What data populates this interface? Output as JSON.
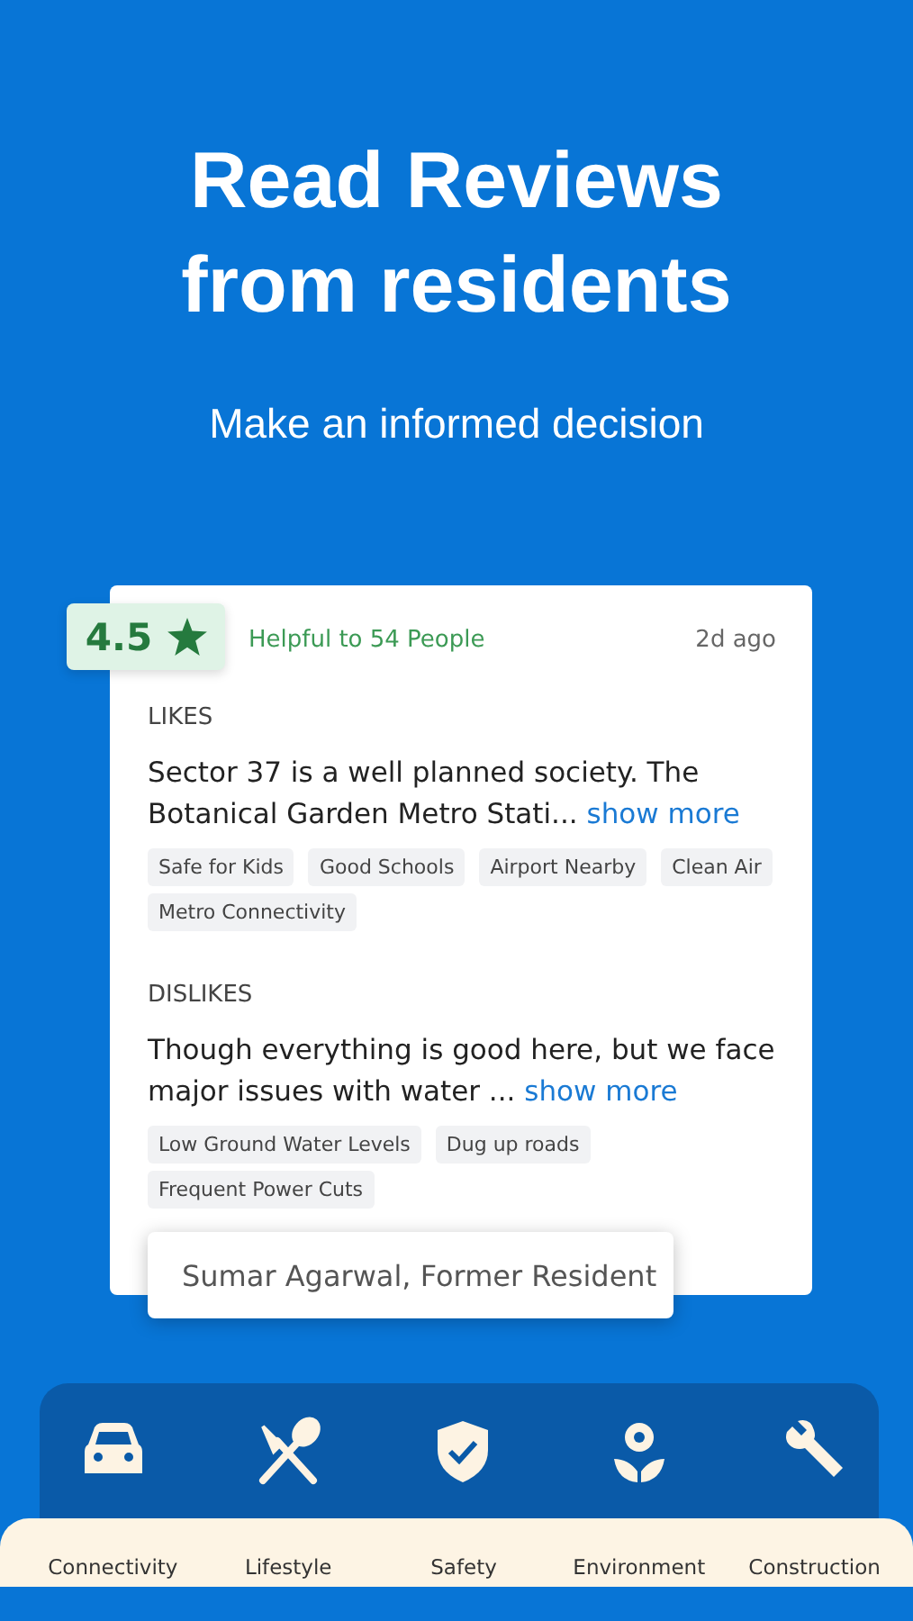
{
  "hero": {
    "title": "Read Reviews from residents",
    "subtitle": "Make an informed decision"
  },
  "review": {
    "rating": "4.5",
    "helpful": "Helpful to 54 People",
    "time": "2d ago",
    "sections": [
      {
        "heading": "LIKES",
        "text": "Sector 37 is a well planned society. The Botanical Garden Metro Stati...",
        "link": "show more",
        "tags": [
          "Safe for Kids",
          "Good Schools",
          "Airport Nearby",
          "Clean Air",
          "Metro Connectivity"
        ]
      },
      {
        "heading": "DISLIKES",
        "text": "Though everything is good here, but we face major issues with water ...",
        "link": "show more",
        "tags": [
          "Low Ground Water Levels",
          "Dug up roads",
          "Frequent Power Cuts"
        ]
      }
    ],
    "author": "Sumar Agarwal, Former Resident"
  },
  "categories": [
    {
      "label": "Connectivity"
    },
    {
      "label": "Lifestyle"
    },
    {
      "label": "Safety"
    },
    {
      "label": "Environment"
    },
    {
      "label": "Construction"
    }
  ]
}
